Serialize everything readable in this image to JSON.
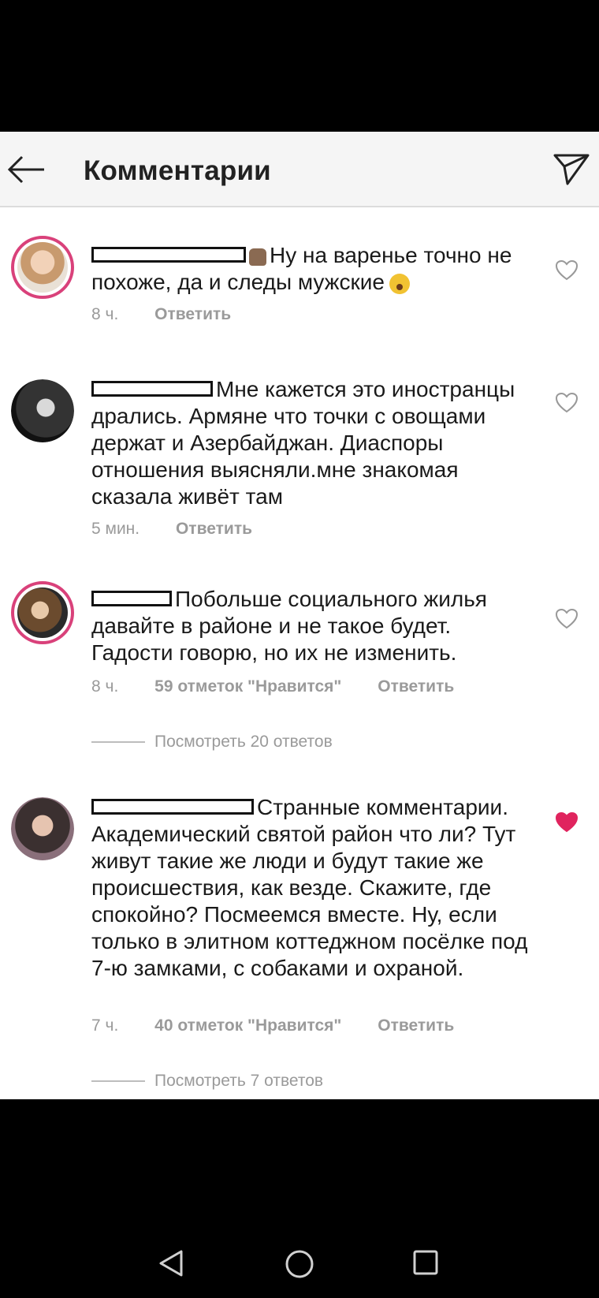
{
  "header": {
    "title": "Комментарии"
  },
  "comments": [
    {
      "text": "Ну на варенье точно не похоже, да и следы мужские",
      "time": "8 ч.",
      "likes": "",
      "reply": "Ответить",
      "liked": false
    },
    {
      "text": "Мне кажется это иностранцы дрались. Армяне что точки с овощами держат и Азербайджан. Диаспоры отношения выясняли.мне знакомая сказала живёт там",
      "time": "5 мин.",
      "likes": "",
      "reply": "Ответить",
      "liked": false
    },
    {
      "text": "Побольше социального жилья давайте в районе и не такое будет. Гадости говорю, но их не изменить.",
      "time": "8 ч.",
      "likes": "59 отметок \"Нравится\"",
      "reply": "Ответить",
      "view_replies": "Посмотреть 20 ответов",
      "liked": false
    },
    {
      "text": "Странные комментарии. Академический святой район что ли? Тут живут такие же люди и будут такие же происшествия, как везде. Скажите, где спокойно?  Посмеемся вместе.  Ну, если только в элитном коттеджном посёлке под 7-ю замками, с собаками и охраной.",
      "time": "7 ч.",
      "likes": "40 отметок \"Нравится\"",
      "reply": "Ответить",
      "view_replies": "Посмотреть 7 ответов",
      "liked": true
    }
  ],
  "colors": {
    "accent_heart": "#e0245e",
    "story_ring": "#d9417a"
  },
  "icons": [
    "back-arrow-icon",
    "send-icon",
    "heart-outline-icon",
    "heart-filled-icon",
    "nav-back-icon",
    "nav-home-icon",
    "nav-recents-icon"
  ]
}
